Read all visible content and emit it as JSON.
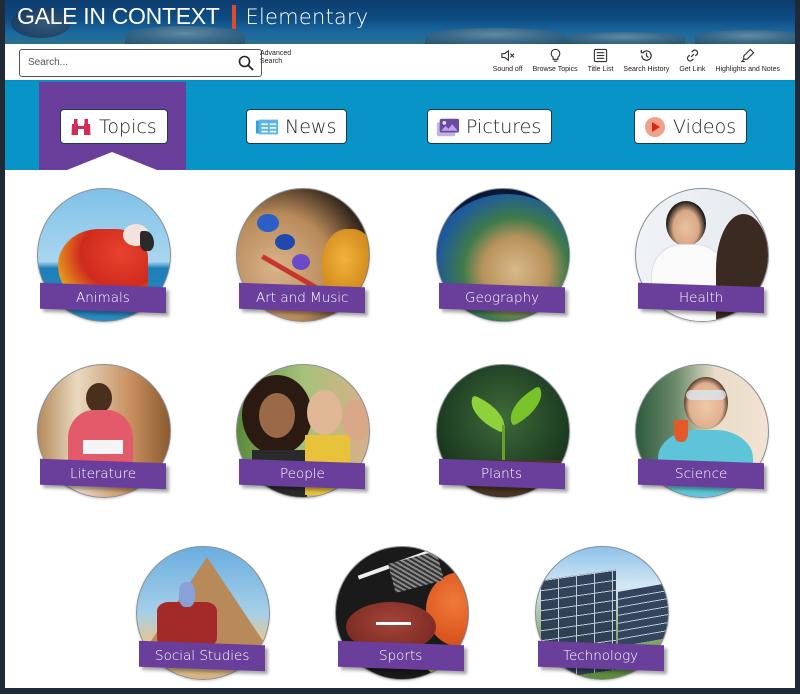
{
  "header": {
    "brand_name": "GALE IN CONTEXT",
    "brand_level": "Elementary",
    "accent_color": "#e04a24"
  },
  "toolbar": {
    "search": {
      "placeholder": "Search...",
      "value": ""
    },
    "advanced_search_line1": "Advanced",
    "advanced_search_line2": "Search",
    "tools": [
      {
        "label": "Sound off",
        "icon": "speaker-mute-icon"
      },
      {
        "label": "Browse Topics",
        "icon": "lightbulb-icon"
      },
      {
        "label": "Title List",
        "icon": "list-icon"
      },
      {
        "label": "Search History",
        "icon": "history-icon"
      },
      {
        "label": "Get Link",
        "icon": "link-icon"
      },
      {
        "label": "Highlights and Notes",
        "icon": "highlighter-icon"
      }
    ]
  },
  "tabs": [
    {
      "label": "Topics",
      "icon": "binoculars-icon",
      "active": true
    },
    {
      "label": "News",
      "icon": "newspaper-icon",
      "active": false
    },
    {
      "label": "Pictures",
      "icon": "image-gallery-icon",
      "active": false
    },
    {
      "label": "Videos",
      "icon": "play-icon",
      "active": false
    }
  ],
  "colors": {
    "tab_bar": "#0994c8",
    "active_tab": "#6a3f9c",
    "ribbon": "#6a3f9c"
  },
  "topics": [
    {
      "label": "Animals",
      "image": "parrot"
    },
    {
      "label": "Art and Music",
      "image": "paint-palette-violin"
    },
    {
      "label": "Geography",
      "image": "earth-globe"
    },
    {
      "label": "Health",
      "image": "doctor-with-child"
    },
    {
      "label": "Literature",
      "image": "boy-reading"
    },
    {
      "label": "People",
      "image": "group-of-girls"
    },
    {
      "label": "Plants",
      "image": "seedling"
    },
    {
      "label": "Science",
      "image": "girl-with-beaker"
    },
    {
      "label": "Social Studies",
      "image": "pyramid-camel"
    },
    {
      "label": "Sports",
      "image": "sports-balls"
    },
    {
      "label": "Technology",
      "image": "solar-panels"
    }
  ]
}
